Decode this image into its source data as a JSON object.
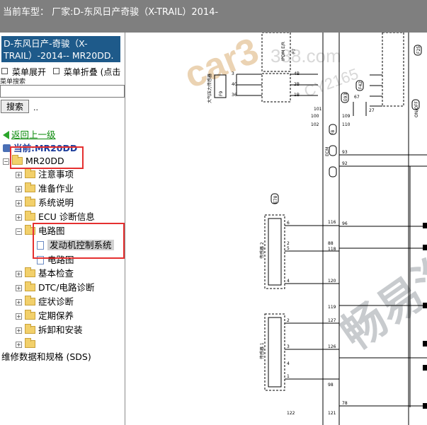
{
  "topbar": {
    "title": "当前车型： 厂家:D-东风日产奇骏（X-TRAIL）2014-"
  },
  "sidebar": {
    "model_box": "D-东风日产-奇骏（X-TRAIL）-2014-- MR20DD.",
    "expand_menu": "菜单展开",
    "collapse_menu": "菜单折叠 (点击",
    "search_label": "菜单搜索",
    "search_placeholder": "",
    "search_button": "搜索",
    "search_dots": "..",
    "back_link": "返回上一级",
    "current": "当前:MR20DD",
    "tree": {
      "root": "MR20DD",
      "items": [
        "注意事项",
        "准备作业",
        "系统说明",
        "ECU 诊断信息",
        "电路图",
        "基本检查",
        "DTC/电路诊断",
        "症状诊断",
        "定期保养",
        "拆卸和安装",
        ""
      ],
      "sub_items": [
        "发动机控制系统",
        "电路图"
      ],
      "footer": "维修数据和规格 (SDS)"
    }
  },
  "diagram": {
    "watermark_brand": "car3",
    "watermark_site": "388.com",
    "watermark_code": "CY2165",
    "watermark_cn": "畅易汽",
    "labels": {
      "ipdm": "IPDM E/R",
      "ipdm_code": "F7",
      "maf": "大气压力传感器",
      "maf_code": "F9",
      "ecm": "ECM",
      "ecm_code": "F8",
      "sensor2": "传感器 2",
      "sensor1": "传感器 1",
      "connector_code": "E78",
      "e93": "E93",
      "f42": "F42",
      "f25": "F25",
      "onoff": "ON/OFF"
    },
    "pins_upper": [
      "3",
      "40",
      "36",
      "4B",
      "2B",
      "1B"
    ],
    "pins_ecm": [
      "93",
      "92",
      "96",
      "116",
      "118",
      "120",
      "127",
      "126",
      "78"
    ],
    "pins_s2": [
      "6",
      "5",
      "4",
      "2"
    ],
    "pins_s1": [
      "2",
      "3",
      "1",
      "4"
    ],
    "pin_labels": [
      "67",
      "100",
      "101",
      "109",
      "110",
      "102",
      "27",
      "119",
      "88",
      "98",
      "121",
      "122"
    ]
  }
}
